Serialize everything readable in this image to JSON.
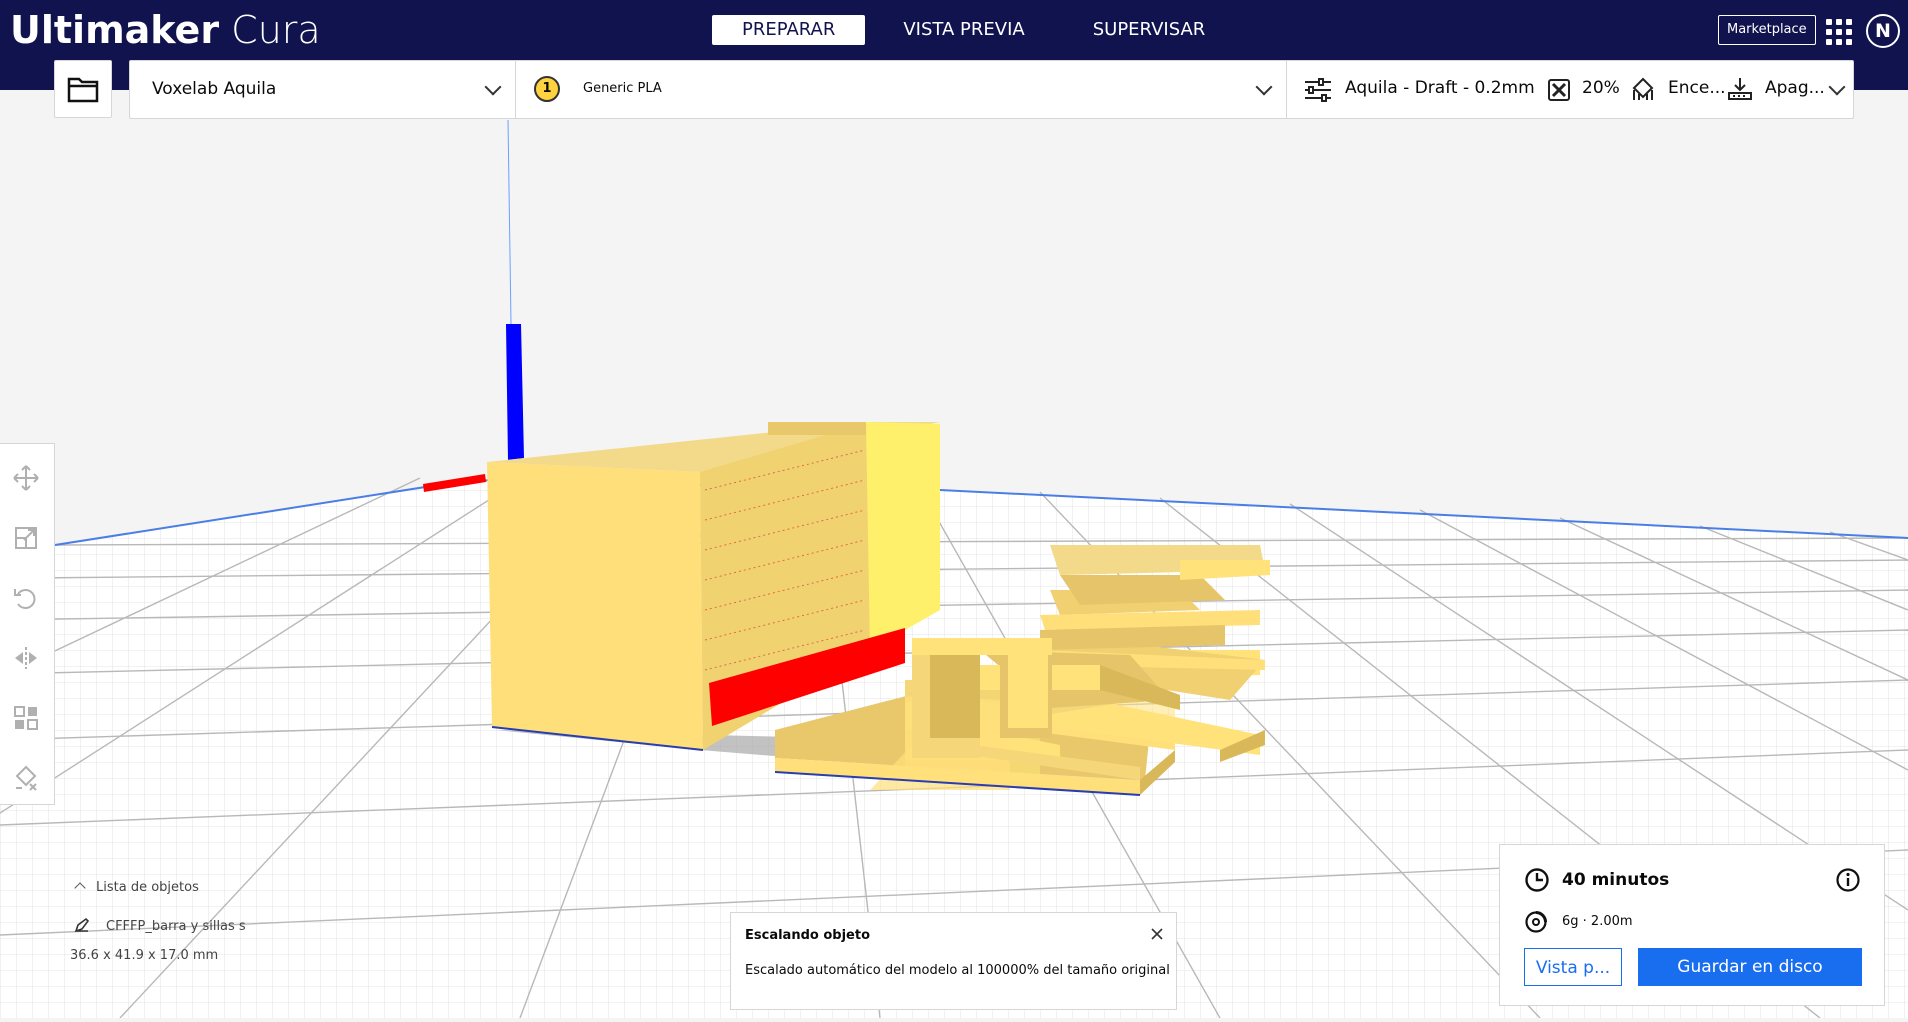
{
  "header": {
    "brand_bold": "Ultimaker",
    "brand_light": "Cura",
    "tabs": [
      {
        "label": "PREPARAR"
      },
      {
        "label": "VISTA PREVIA"
      },
      {
        "label": "SUPERVISAR"
      }
    ],
    "marketplace_label": "Marketplace",
    "account_initial": "N"
  },
  "toolbar": {
    "printer_name": "Voxelab Aquila",
    "extruder_number": "1",
    "material_name": "Generic PLA",
    "profile_label": "Aquila - Draft - 0.2mm",
    "infill_label": "20%",
    "support_label": "Ence...",
    "adhesion_label": "Apag..."
  },
  "object_list": {
    "toggle_label": "Lista de objetos",
    "object_name": "CFFFP_barra y sillas s",
    "dimensions": "36.6 x 41.9 x 17.0 mm"
  },
  "message": {
    "title": "Escalando objeto",
    "body": "Escalado automático del modelo al 100000% del tamaño original"
  },
  "action_panel": {
    "print_time": "40 minutos",
    "material_estimate": "6g · 2.00m",
    "preview_label": "Vista p...",
    "save_label": "Guardar en disco"
  },
  "colors": {
    "header_bg": "#11134f",
    "accent_blue": "#196ef0",
    "model_yellow": "#ffe27a",
    "overhang_red": "#ff0000"
  }
}
